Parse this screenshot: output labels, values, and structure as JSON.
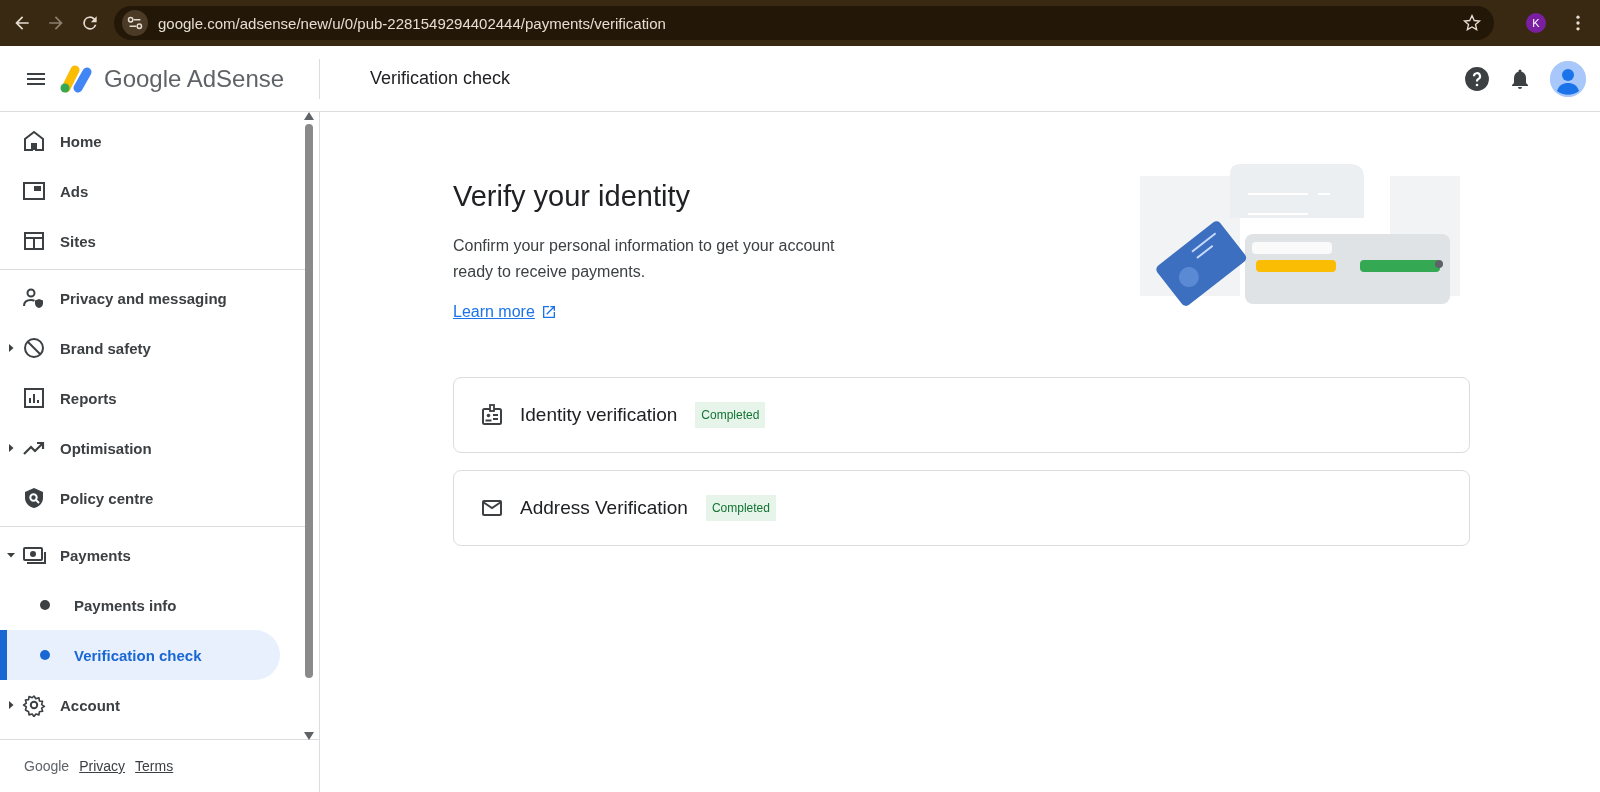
{
  "browser": {
    "url": "google.com/adsense/new/u/0/pub-2281549294402444/payments/verification",
    "profile_initial": "K"
  },
  "app_bar": {
    "product": "Google AdSense",
    "page_title": "Verification check"
  },
  "sidebar": {
    "sections": [
      [
        {
          "label": "Home",
          "kind": "link",
          "selected": false
        },
        {
          "label": "Ads",
          "kind": "link",
          "selected": false
        },
        {
          "label": "Sites",
          "kind": "link",
          "selected": false
        }
      ],
      [
        {
          "label": "Privacy and messaging",
          "kind": "link",
          "selected": false
        },
        {
          "label": "Brand safety",
          "kind": "group",
          "expanded": false,
          "selected": false
        },
        {
          "label": "Reports",
          "kind": "link",
          "selected": false
        },
        {
          "label": "Optimisation",
          "kind": "group",
          "expanded": false,
          "selected": false
        },
        {
          "label": "Policy centre",
          "kind": "link",
          "selected": false
        }
      ],
      [
        {
          "label": "Payments",
          "kind": "group",
          "expanded": true,
          "selected": false
        },
        {
          "label": "Payments info",
          "kind": "sub",
          "selected": false
        },
        {
          "label": "Verification check",
          "kind": "sub",
          "selected": true
        },
        {
          "label": "Account",
          "kind": "group",
          "expanded": false,
          "selected": false
        }
      ]
    ],
    "footer": {
      "brand": "Google",
      "links": [
        "Privacy",
        "Terms"
      ]
    }
  },
  "main": {
    "heading": "Verify your identity",
    "description": "Confirm your personal information to get your account ready to receive payments.",
    "link": "Learn more",
    "cards": [
      {
        "title": "Identity verification",
        "status": "Completed"
      },
      {
        "title": "Address Verification",
        "status": "Completed"
      }
    ]
  }
}
